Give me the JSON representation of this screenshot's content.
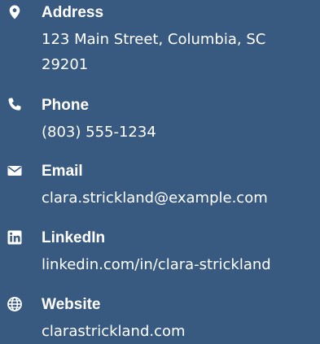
{
  "contacts": {
    "address": {
      "icon": "map-marker-icon",
      "label": "Address",
      "value": "123 Main Street, Columbia, SC 29201"
    },
    "phone": {
      "icon": "phone-icon",
      "label": "Phone",
      "value": "(803) 555-1234"
    },
    "email": {
      "icon": "envelope-icon",
      "label": "Email",
      "value": "clara.strickland@example.com"
    },
    "linkedin": {
      "icon": "linkedin-icon",
      "label": "LinkedIn",
      "value": "linkedin.com/in/clara-strickland"
    },
    "website": {
      "icon": "globe-icon",
      "label": "Website",
      "value": "clarastrickland.com"
    }
  },
  "colors": {
    "background": "#395a80",
    "text": "#ffffff"
  }
}
